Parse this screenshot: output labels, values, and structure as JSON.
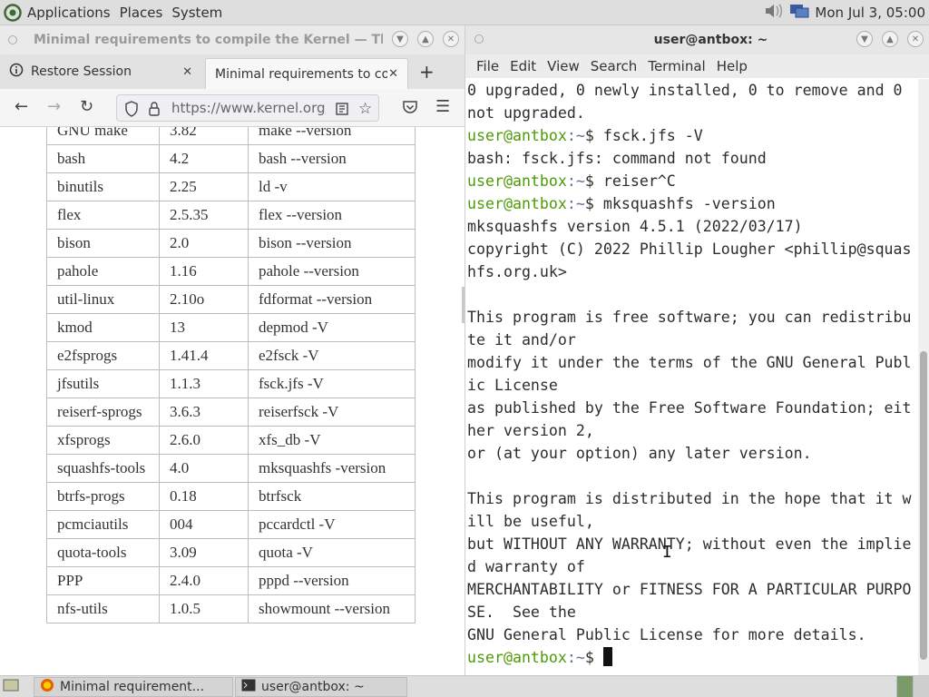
{
  "top_panel": {
    "menus": [
      "Applications",
      "Places",
      "System"
    ],
    "clock": "Mon Jul 3, 05:00",
    "icons": [
      "mate-logo-icon",
      "volume-icon",
      "network-icon"
    ]
  },
  "firefox": {
    "window_title": "Minimal requirements to compile the Kernel — The Lin...",
    "tabs": [
      {
        "label": "Restore Session"
      },
      {
        "label": "Minimal requirements to compile the Kernel"
      }
    ],
    "url": "https://www.kernel.org/",
    "table_rows": [
      [
        "GNU make",
        "3.82",
        "make --version"
      ],
      [
        "bash",
        "4.2",
        "bash --version"
      ],
      [
        "binutils",
        "2.25",
        "ld -v"
      ],
      [
        "flex",
        "2.5.35",
        "flex --version"
      ],
      [
        "bison",
        "2.0",
        "bison --version"
      ],
      [
        "pahole",
        "1.16",
        "pahole --version"
      ],
      [
        "util-linux",
        "2.10o",
        "fdformat --version"
      ],
      [
        "kmod",
        "13",
        "depmod -V"
      ],
      [
        "e2fsprogs",
        "1.41.4",
        "e2fsck -V"
      ],
      [
        "jfsutils",
        "1.1.3",
        "fsck.jfs -V"
      ],
      [
        "reiserf-sprogs",
        "3.6.3",
        "reiserfsck -V"
      ],
      [
        "xfsprogs",
        "2.6.0",
        "xfs_db -V"
      ],
      [
        "squashfs-tools",
        "4.0",
        "mksquashfs -version"
      ],
      [
        "btrfs-progs",
        "0.18",
        "btrfsck"
      ],
      [
        "pcmciautils",
        "004",
        "pccardctl -V"
      ],
      [
        "quota-tools",
        "3.09",
        "quota -V"
      ],
      [
        "PPP",
        "2.4.0",
        "pppd --version"
      ],
      [
        "nfs-utils",
        "1.0.5",
        "showmount --version"
      ]
    ]
  },
  "terminal": {
    "window_title": "user@antbox: ~",
    "menu": [
      "File",
      "Edit",
      "View",
      "Search",
      "Terminal",
      "Help"
    ],
    "prompt_user": "user@antbox",
    "prompt_path": ":~",
    "prompt_sym": "$ ",
    "lines": [
      {
        "type": "out",
        "text": "0 upgraded, 0 newly installed, 0 to remove and 0"
      },
      {
        "type": "out",
        "text": "not upgraded."
      },
      {
        "type": "cmd",
        "text": "fsck.jfs -V"
      },
      {
        "type": "out",
        "text": "bash: fsck.jfs: command not found"
      },
      {
        "type": "cmd",
        "text": "reiser^C"
      },
      {
        "type": "cmd",
        "text": "mksquashfs -version"
      },
      {
        "type": "out",
        "text": "mksquashfs version 4.5.1 (2022/03/17)"
      },
      {
        "type": "out",
        "text": "copyright (C) 2022 Phillip Lougher <phillip@squas"
      },
      {
        "type": "out",
        "text": "hfs.org.uk>"
      },
      {
        "type": "out",
        "text": ""
      },
      {
        "type": "out",
        "text": "This program is free software; you can redistribu"
      },
      {
        "type": "out",
        "text": "te it and/or"
      },
      {
        "type": "out",
        "text": "modify it under the terms of the GNU General Publ"
      },
      {
        "type": "out",
        "text": "ic License"
      },
      {
        "type": "out",
        "text": "as published by the Free Software Foundation; eit"
      },
      {
        "type": "out",
        "text": "her version 2,"
      },
      {
        "type": "out",
        "text": "or (at your option) any later version."
      },
      {
        "type": "out",
        "text": ""
      },
      {
        "type": "out",
        "text": "This program is distributed in the hope that it w"
      },
      {
        "type": "out",
        "text": "ill be useful,"
      },
      {
        "type": "out",
        "text": "but WITHOUT ANY WARRANTY; without even the implie"
      },
      {
        "type": "out",
        "text": "d warranty of"
      },
      {
        "type": "out",
        "text": "MERCHANTABILITY or FITNESS FOR A PARTICULAR PURPO"
      },
      {
        "type": "out",
        "text": "SE.  See the"
      },
      {
        "type": "out",
        "text": "GNU General Public License for more details."
      },
      {
        "type": "prompt",
        "text": ""
      }
    ]
  },
  "taskbar": {
    "items": [
      {
        "label": "Minimal requirement..."
      },
      {
        "label": "user@antbox: ~"
      }
    ]
  }
}
